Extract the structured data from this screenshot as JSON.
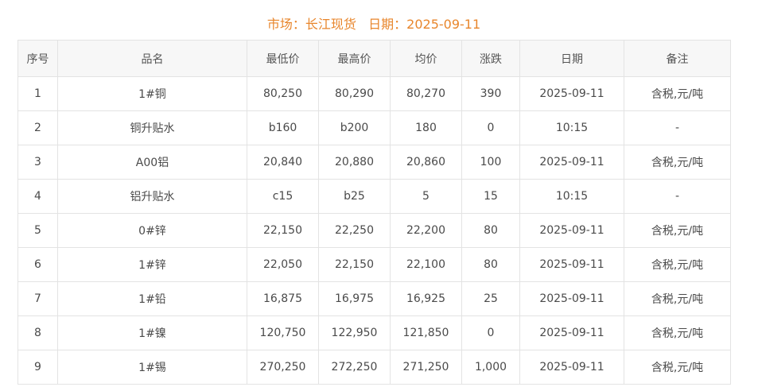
{
  "header": {
    "market_label": "市场：",
    "market_value": "长江现货",
    "date_label": "日期：",
    "date_value": "2025-09-11"
  },
  "table": {
    "columns": [
      "序号",
      "品名",
      "最低价",
      "最高价",
      "均价",
      "涨跌",
      "日期",
      "备注"
    ],
    "rows": [
      {
        "idx": "1",
        "name": "1#铜",
        "low": "80,250",
        "high": "80,290",
        "avg": "80,270",
        "change": "390",
        "date": "2025-09-11",
        "note": "含税,元/吨"
      },
      {
        "idx": "2",
        "name": "铜升贴水",
        "low": "b160",
        "high": "b200",
        "avg": "180",
        "change": "0",
        "date": "10:15",
        "note": "-"
      },
      {
        "idx": "3",
        "name": "A00铝",
        "low": "20,840",
        "high": "20,880",
        "avg": "20,860",
        "change": "100",
        "date": "2025-09-11",
        "note": "含税,元/吨"
      },
      {
        "idx": "4",
        "name": "铝升贴水",
        "low": "c15",
        "high": "b25",
        "avg": "5",
        "change": "15",
        "date": "10:15",
        "note": "-"
      },
      {
        "idx": "5",
        "name": "0#锌",
        "low": "22,150",
        "high": "22,250",
        "avg": "22,200",
        "change": "80",
        "date": "2025-09-11",
        "note": "含税,元/吨"
      },
      {
        "idx": "6",
        "name": "1#锌",
        "low": "22,050",
        "high": "22,150",
        "avg": "22,100",
        "change": "80",
        "date": "2025-09-11",
        "note": "含税,元/吨"
      },
      {
        "idx": "7",
        "name": "1#铅",
        "low": "16,875",
        "high": "16,975",
        "avg": "16,925",
        "change": "25",
        "date": "2025-09-11",
        "note": "含税,元/吨"
      },
      {
        "idx": "8",
        "name": "1#镍",
        "low": "120,750",
        "high": "122,950",
        "avg": "121,850",
        "change": "0",
        "date": "2025-09-11",
        "note": "含税,元/吨"
      },
      {
        "idx": "9",
        "name": "1#锡",
        "low": "270,250",
        "high": "272,250",
        "avg": "271,250",
        "change": "1,000",
        "date": "2025-09-11",
        "note": "含税,元/吨"
      }
    ]
  },
  "colors": {
    "title": "#e8862c",
    "change_up": "#d0021b",
    "change_zero": "#a9a9a9",
    "header_bg": "#f7f7f7",
    "border": "#e3e3e3"
  }
}
